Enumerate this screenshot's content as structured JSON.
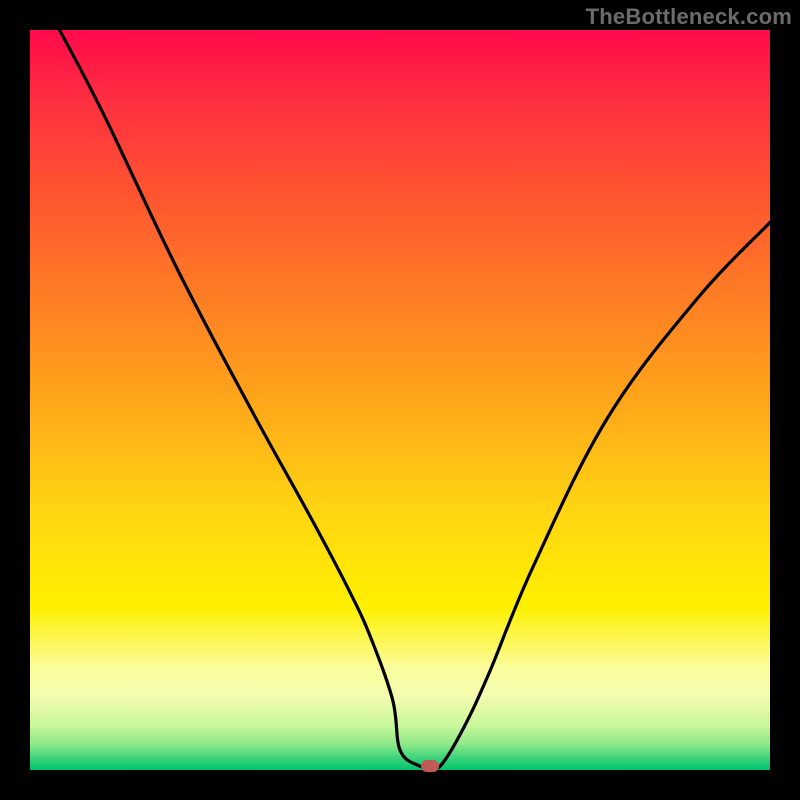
{
  "watermark": "TheBottleneck.com",
  "chart_data": {
    "type": "line",
    "title": "",
    "xlabel": "",
    "ylabel": "",
    "xlim": [
      0,
      100
    ],
    "ylim": [
      0,
      100
    ],
    "series": [
      {
        "name": "curve",
        "x": [
          4,
          10,
          20,
          30,
          38,
          43,
          46,
          49,
          50,
          52.5,
          54,
          55.5,
          58.5,
          62,
          68,
          78,
          90,
          100
        ],
        "values": [
          100,
          88.5,
          67.5,
          48.5,
          34,
          24.5,
          18,
          9.5,
          2.7,
          0.6,
          0.5,
          0.6,
          5.5,
          13,
          27.5,
          47.5,
          63.5,
          74
        ]
      }
    ],
    "marker": {
      "x": 54,
      "y": 0.6
    },
    "grid": false,
    "legend": false
  },
  "colors": {
    "curve_stroke": "#000000",
    "marker_fill": "#c15a57"
  }
}
